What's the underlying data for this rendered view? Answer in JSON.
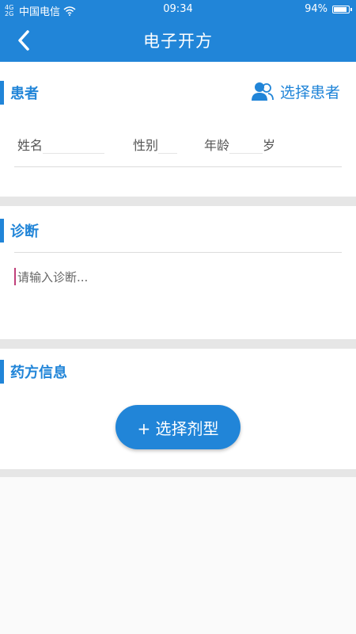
{
  "status_bar": {
    "signal_text": "4G 2G",
    "carrier": "中国电信",
    "time": "09:34",
    "battery": "94%",
    "battery_level": 0.94
  },
  "header": {
    "title": "电子开方",
    "back_icon": "chevron-left-icon",
    "bg_color": "#2185d8"
  },
  "patient": {
    "section_title": "患者",
    "select_label": "选择患者",
    "select_icon": "users-icon",
    "name_label": "姓名",
    "name_value": "",
    "gender_label": "性别",
    "gender_value": "",
    "age_label": "年龄",
    "age_value": "",
    "age_unit": "岁"
  },
  "diagnosis": {
    "section_title": "诊断",
    "placeholder": "请输入诊断..."
  },
  "prescription": {
    "section_title": "药方信息",
    "select_button": "+ 选择剂型"
  }
}
